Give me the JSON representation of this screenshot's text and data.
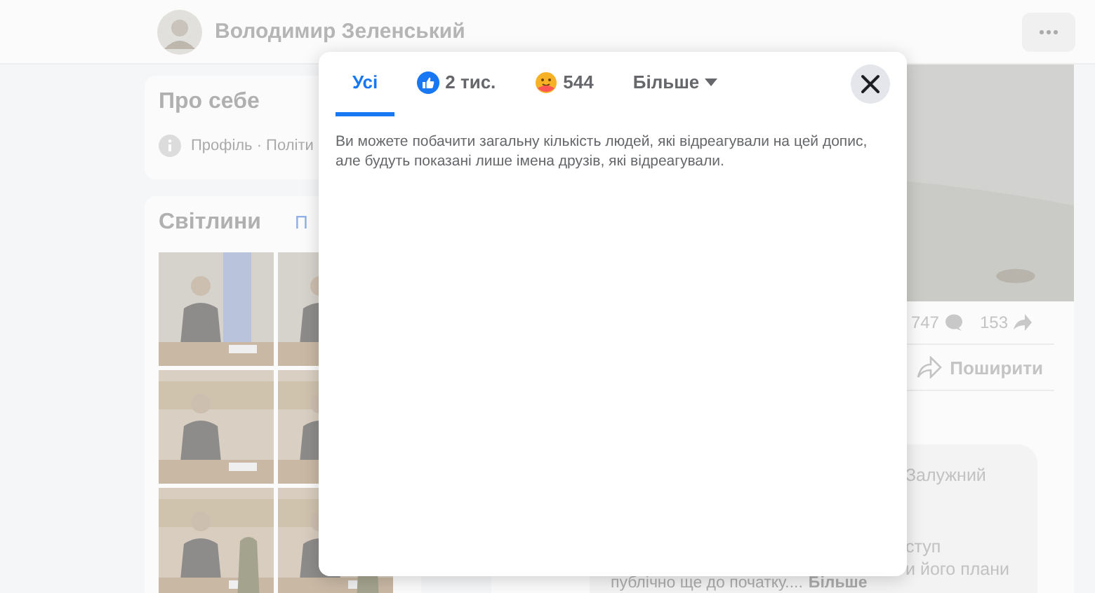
{
  "header": {
    "name": "Володимир Зеленський"
  },
  "about": {
    "title": "Про себе",
    "line": "Профіль · Політи"
  },
  "photos": {
    "title": "Світлини",
    "link": "П"
  },
  "post": {
    "comments": "747",
    "shares": "153",
    "share_button": "Поширити",
    "comment_lines": [
      "Залужний",
      "ступ",
      "и його плани"
    ],
    "comment_tail": "публічно ще до початку....",
    "more_link": "Більше"
  },
  "modal": {
    "tabs": [
      {
        "label": "Усі",
        "kind": "all",
        "selected": true
      },
      {
        "label": "2 тис.",
        "kind": "like",
        "selected": false
      },
      {
        "label": "544",
        "kind": "care",
        "selected": false
      },
      {
        "label": "Більше",
        "kind": "more",
        "selected": false
      }
    ],
    "notice": "Ви можете побачити загальну кількість людей, які відреагували на цей допис, але будуть показані лише імена друзів, які відреагували."
  }
}
